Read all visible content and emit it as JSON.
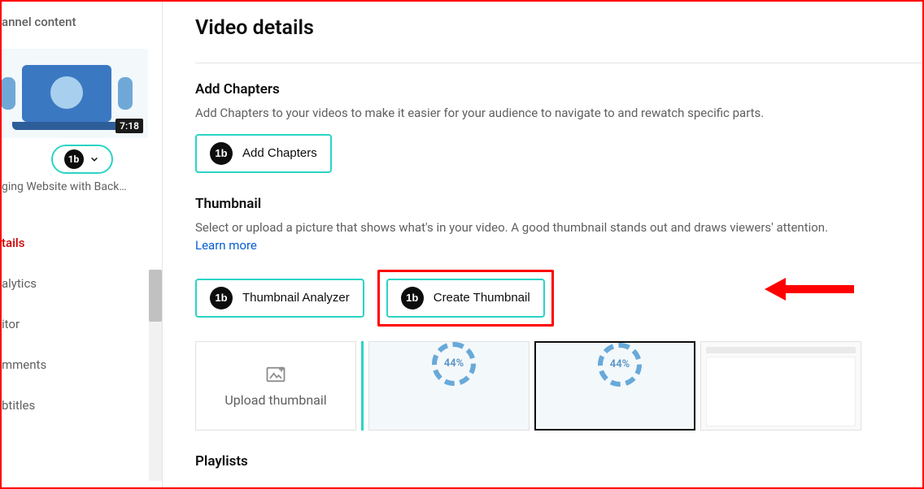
{
  "sidebar": {
    "header": "annel content",
    "video_duration": "7:18",
    "video_title": "ging Website with Back…",
    "nav": [
      "tails",
      "alytics",
      "itor",
      "mments",
      "btitles"
    ],
    "active_index": 0
  },
  "page": {
    "title": "Video details"
  },
  "chapters": {
    "title": "Add Chapters",
    "desc": "Add Chapters to your videos to make it easier for your audience to navigate to and rewatch specific parts.",
    "button": "Add Chapters"
  },
  "thumbnail": {
    "title": "Thumbnail",
    "desc": "Select or upload a picture that shows what's in your video. A good thumbnail stands out and draws viewers' attention.",
    "learn_more": "Learn more",
    "analyzer_button": "Thumbnail Analyzer",
    "create_button": "Create Thumbnail",
    "upload_label": "Upload thumbnail",
    "auto_percent": "44%"
  },
  "playlists": {
    "title": "Playlists"
  },
  "icons": {
    "tb": "1b"
  }
}
